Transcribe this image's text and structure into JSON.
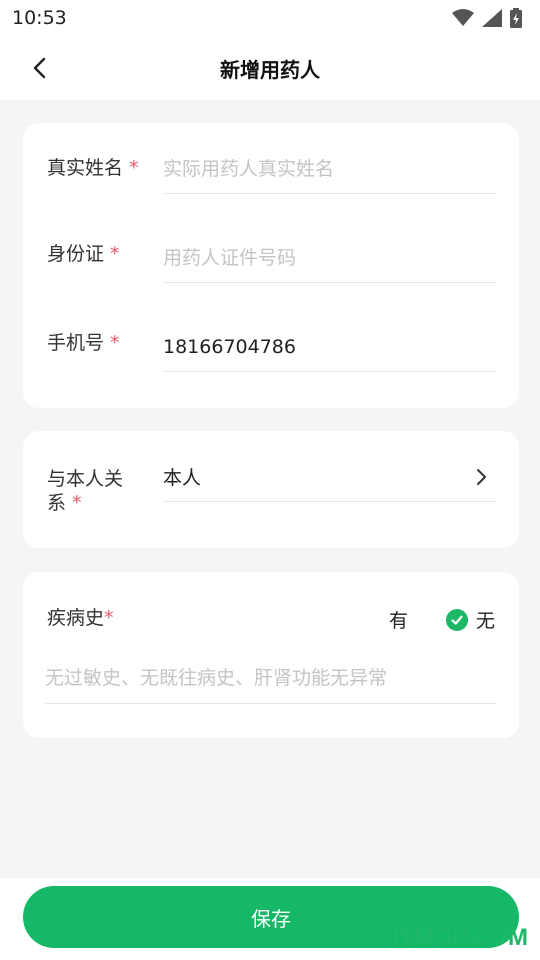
{
  "status_bar": {
    "time": "10:53",
    "wifi_icon": "wifi-icon",
    "signal_icon": "signal-icon",
    "battery_icon": "battery-charging-icon"
  },
  "header": {
    "title": "新增用药人",
    "back_icon": "chevron-left-icon"
  },
  "form": {
    "name": {
      "label": "真实姓名",
      "required": "*",
      "placeholder": "实际用药人真实姓名",
      "value": ""
    },
    "id_card": {
      "label": "身份证",
      "required": "*",
      "placeholder": "用药人证件号码",
      "value": ""
    },
    "phone": {
      "label": "手机号",
      "required": "*",
      "placeholder": "",
      "value": "18166704786"
    },
    "relation": {
      "label_line1": "与本人关",
      "label_line2": "系",
      "required": "*",
      "value": "本人",
      "chevron_icon": "chevron-right-icon"
    },
    "history": {
      "label": "疾病史",
      "required": "*",
      "options": [
        {
          "label": "有",
          "checked": false
        },
        {
          "label": "无",
          "checked": true
        }
      ],
      "placeholder": "无过敏史、无既往病史、肝肾功能无异常",
      "value": ""
    }
  },
  "footer": {
    "save_label": "保存"
  },
  "watermark": "ITMOP.COM",
  "colors": {
    "accent": "#14b866",
    "required": "#e55a6c",
    "background": "#f5f5f5"
  }
}
